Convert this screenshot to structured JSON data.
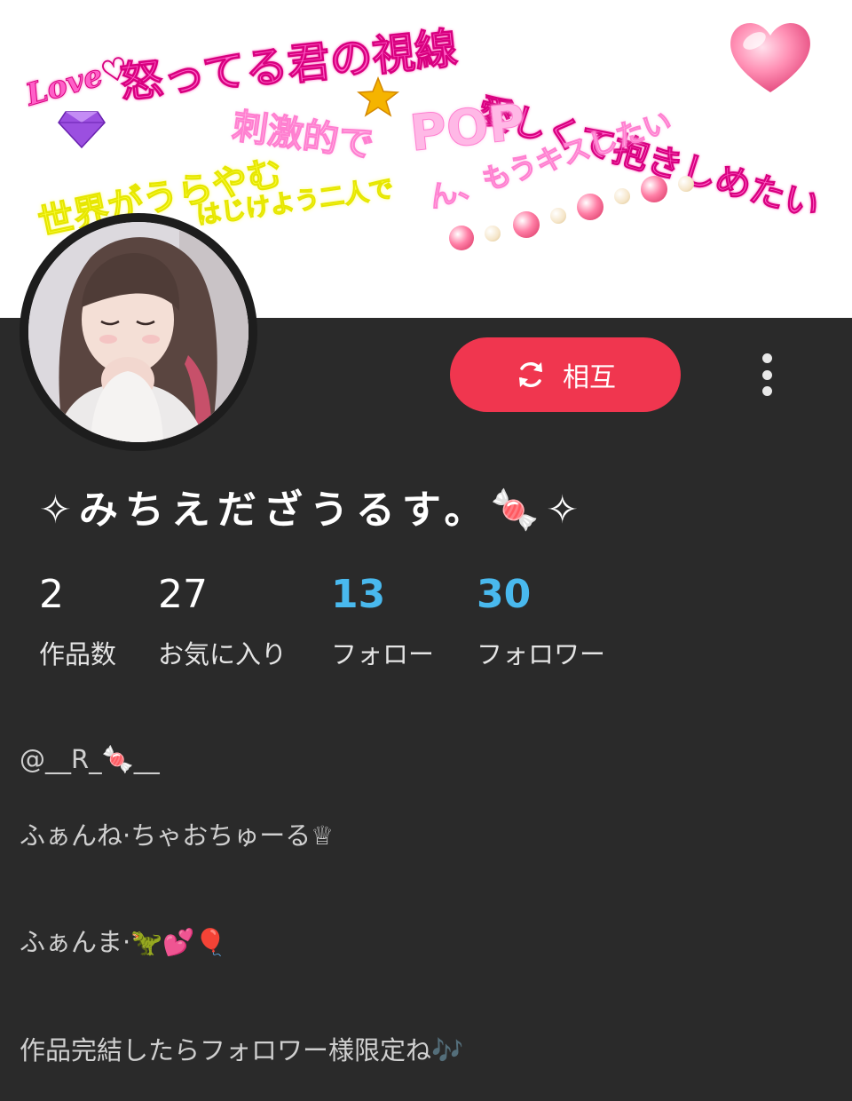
{
  "banner": {
    "texts": {
      "love": "Love♡",
      "line1": "怒ってる君の視線",
      "line2": "愛しくて抱きしめたい",
      "line3a": "刺激的で",
      "line3b": "POP",
      "line4": "世界がうらやむ",
      "line5": "はじけよう二人で",
      "line6": "ん、もうキスしたい"
    }
  },
  "profile": {
    "follow_button_label": "相互",
    "display_name": "✧みちえだざうるす。🍬✧",
    "stats": [
      {
        "value": "2",
        "label": "作品数"
      },
      {
        "value": "27",
        "label": "お気に入り"
      },
      {
        "value": "13",
        "label": "フォロー"
      },
      {
        "value": "30",
        "label": "フォロワー"
      }
    ],
    "bio": [
      "@__R_🍬__",
      "ふぁんね·ちゃおちゅーる♕",
      "ふぁんま·🦖💕🎈",
      "作品完結したらフォロワー様限定ね🎶"
    ]
  },
  "colors": {
    "background": "#2a2a2a",
    "follow_button": "#f0364f",
    "stat_highlight": "#49b9ee"
  },
  "icons": {
    "follow_button_icon": "refresh-icon",
    "more_menu_icon": "vertical-dots-icon"
  }
}
